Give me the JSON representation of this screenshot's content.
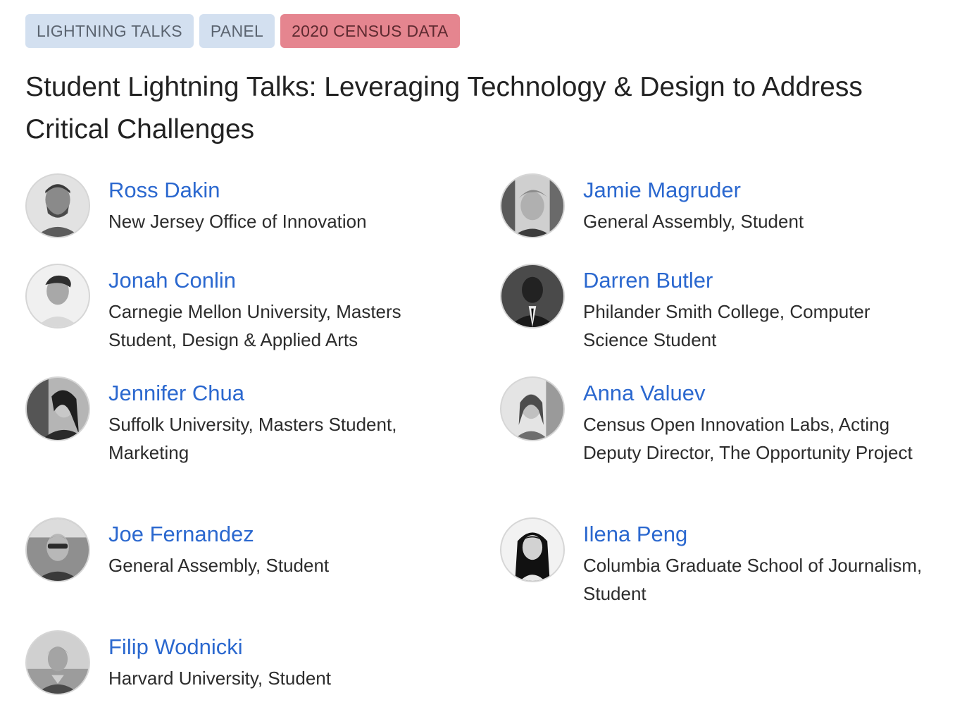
{
  "tags": [
    {
      "label": "LIGHTNING TALKS"
    },
    {
      "label": "PANEL"
    },
    {
      "label": "2020 CENSUS DATA",
      "color": "#e5858f"
    }
  ],
  "session": {
    "title": "Student Lightning Talks: Leveraging Technology & Design to Address Critical Challenges"
  },
  "speakers": [
    {
      "name": "Ross Dakin",
      "affiliation": "New Jersey Office of Innovation"
    },
    {
      "name": "Jamie Magruder",
      "affiliation": "General Assembly, Student"
    },
    {
      "name": "Jonah Conlin",
      "affiliation": "Carnegie Mellon University, Masters Student, Design & Applied Arts"
    },
    {
      "name": "Darren Butler",
      "affiliation": "Philander Smith College, Computer Science Student"
    },
    {
      "name": "Jennifer Chua",
      "affiliation": "Suffolk University, Masters Student, Marketing"
    },
    {
      "name": "Anna Valuev",
      "affiliation": "Census Open Innovation Labs, Acting Deputy Director, The Opportunity Project"
    },
    {
      "name": "Joe Fernandez",
      "affiliation": "General Assembly, Student"
    },
    {
      "name": "Ilena Peng",
      "affiliation": "Columbia Graduate School of Journalism, Student"
    },
    {
      "name": "Filip Wodnicki",
      "affiliation": "Harvard University, Student"
    }
  ],
  "colors": {
    "link": "#2b68cf",
    "tag_default": "#d3e0f0",
    "tag_highlight": "#e5858f"
  }
}
